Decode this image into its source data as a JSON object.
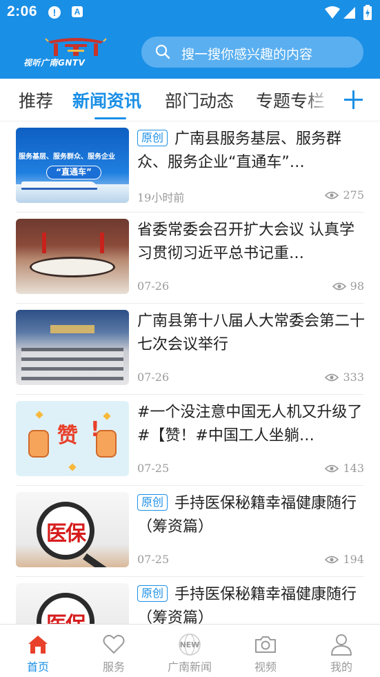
{
  "status_bar": {
    "time": "2:06",
    "alert_icon": "!",
    "a_icon": "A"
  },
  "header": {
    "logo_text": "视听广南GNTV",
    "search": {
      "placeholder": "搜一搜你感兴趣的内容"
    }
  },
  "tabs": [
    {
      "label": "推荐",
      "active": false
    },
    {
      "label": "新闻资讯",
      "active": true
    },
    {
      "label": "部门动态",
      "active": false
    },
    {
      "label": "专题专栏",
      "active": false
    }
  ],
  "news": [
    {
      "badge": "原创",
      "title": "广南县服务基层、服务群众、服务企业“直通车”…",
      "time": "19小时前",
      "views": "275",
      "thumb": {
        "style": "train",
        "banner": "服务基层、服务群众、服务企业",
        "pill": "“直通车”"
      }
    },
    {
      "badge": "",
      "title": "省委常委会召开扩大会议 认真学习贯彻习近平总书记重…",
      "time": "07-26",
      "views": "98",
      "thumb": {
        "style": "meeting1"
      }
    },
    {
      "badge": "",
      "title": "广南县第十八届人大常委会第二十七次会议举行",
      "time": "07-26",
      "views": "333",
      "thumb": {
        "style": "meeting2"
      }
    },
    {
      "badge": "",
      "title": "#一个没注意中国无人机又升级了#【赞！#中国工人坐躺…",
      "time": "07-25",
      "views": "143",
      "thumb": {
        "style": "zan",
        "text": "赞",
        "exclaim": "!"
      }
    },
    {
      "badge": "原创",
      "title": "手持医保秘籍幸福健康随行（筹资篇）",
      "time": "07-25",
      "views": "194",
      "thumb": {
        "style": "yibao",
        "text": "医保"
      }
    },
    {
      "badge": "原创",
      "title": "手持医保秘籍幸福健康随行（筹资篇）",
      "time": "",
      "views": "",
      "thumb": {
        "style": "yibao",
        "text": "医保"
      }
    }
  ],
  "bottom_nav": [
    {
      "label": "首页",
      "icon": "home-icon",
      "active": true
    },
    {
      "label": "服务",
      "icon": "heart-icon",
      "active": false
    },
    {
      "label": "广南新闻",
      "icon": "new-globe-icon",
      "active": false
    },
    {
      "label": "视频",
      "icon": "camera-icon",
      "active": false
    },
    {
      "label": "我的",
      "icon": "user-icon",
      "active": false
    }
  ],
  "bottom_nav_new_label": "NEW",
  "colors": {
    "primary": "#1a8fe6",
    "muted": "#9a9a9a",
    "text": "#222222"
  }
}
